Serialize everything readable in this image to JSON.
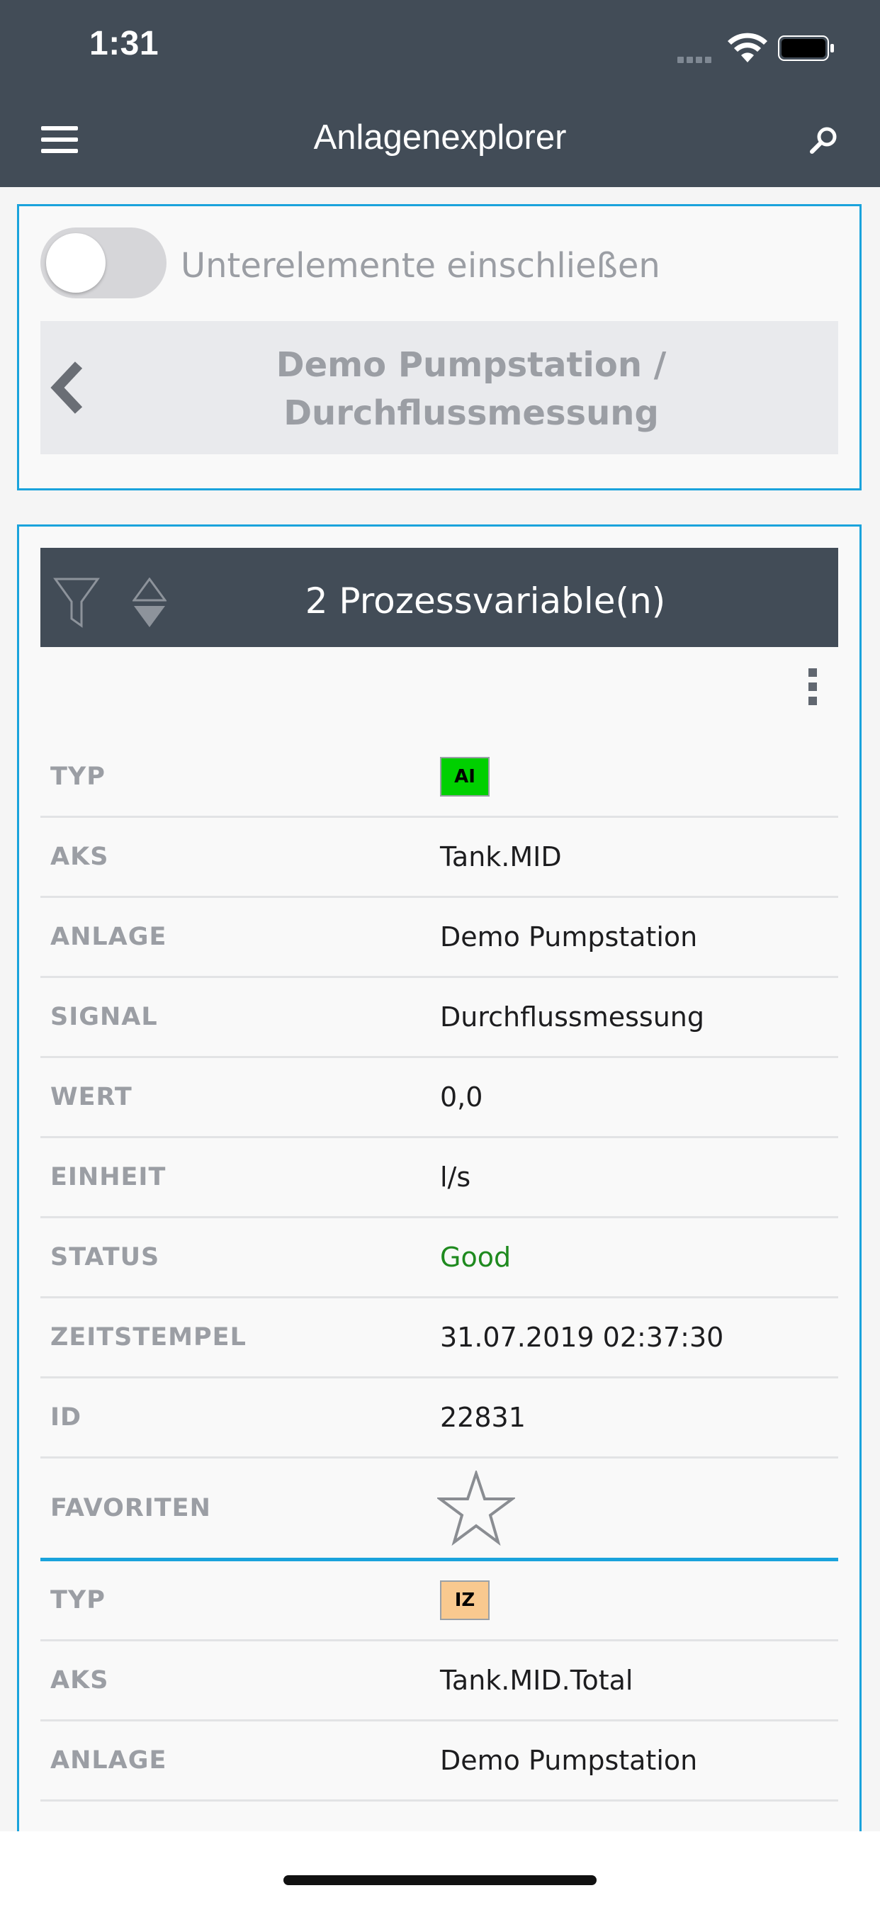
{
  "status_bar": {
    "time": "1:31"
  },
  "header": {
    "title": "Anlagenexplorer"
  },
  "nav_panel": {
    "toggle_label": "Unterelemente einschließen",
    "toggle_on": false,
    "breadcrumb": "Demo Pumpstation / Durchflussmessung"
  },
  "vars_panel": {
    "title": "2 Prozessvariable(n)",
    "records": [
      {
        "typ_label": "TYP",
        "typ": "AI",
        "typ_color": "#00d000",
        "aks_label": "AKS",
        "aks": "Tank.MID",
        "anlage_label": "ANLAGE",
        "anlage": "Demo Pumpstation",
        "signal_label": "SIGNAL",
        "signal": "Durchflussmessung",
        "wert_label": "WERT",
        "wert": "0,0",
        "einheit_label": "EINHEIT",
        "einheit": "l/s",
        "status_label": "STATUS",
        "status": "Good",
        "zeit_label": "ZEITSTEMPEL",
        "zeit": "31.07.2019 02:37:30",
        "id_label": "ID",
        "id": "22831",
        "fav_label": "FAVORITEN"
      },
      {
        "typ_label": "TYP",
        "typ": "IZ",
        "typ_color": "#f9c98f",
        "aks_label": "AKS",
        "aks": "Tank.MID.Total",
        "anlage_label": "ANLAGE",
        "anlage": "Demo Pumpstation"
      }
    ]
  },
  "colors": {
    "accent": "#1aa3dc",
    "header_bg": "#424c57",
    "status_good": "#1f8a1f"
  }
}
